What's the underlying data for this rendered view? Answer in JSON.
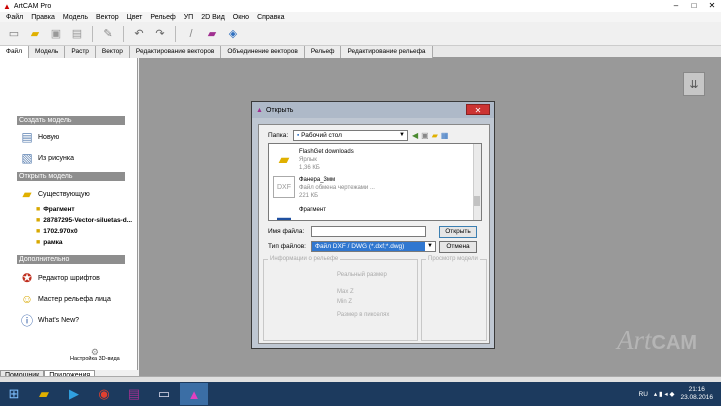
{
  "app": {
    "title": "ArtCAM Pro"
  },
  "window_buttons": [
    "–",
    "□",
    "✕"
  ],
  "menu": [
    "Файл",
    "Правка",
    "Модель",
    "Вектор",
    "Цвет",
    "Рельеф",
    "УП",
    "2D Вид",
    "Окно",
    "Справка"
  ],
  "toolbar": {
    "icons": [
      "new-file-icon",
      "open-folder-icon",
      "save-icon",
      "print-icon",
      "pen-icon",
      "undo-icon",
      "redo-icon",
      "brush-icon",
      "book-icon",
      "layers-icon"
    ]
  },
  "tabs": [
    {
      "label": "Файл",
      "active": true
    },
    {
      "label": "Модель",
      "active": false
    },
    {
      "label": "Растр",
      "active": false
    },
    {
      "label": "Вектор",
      "active": false
    },
    {
      "label": "Редактирование векторов",
      "active": false
    },
    {
      "label": "Объединение векторов",
      "active": false
    },
    {
      "label": "Рельеф",
      "active": false
    },
    {
      "label": "Редактирование рельефа",
      "active": false
    }
  ],
  "left_panel": {
    "create_header": "Создать модель",
    "new_label": "Новую",
    "from_image_label": "Из рисунка",
    "open_header": "Открыть модель",
    "existing_label": "Существующую",
    "recent": [
      "Фрагмент",
      "28787295-Vector-siluetas-d...",
      "1702.970x0",
      "рамка"
    ],
    "extra_header": "Дополнительно",
    "font_editor_label": "Редактор шрифтов",
    "face_relief_label": "Мастер рельефа лица",
    "whats_new_label": "What's New?",
    "view_settings_label": "Настройка 3D-вида"
  },
  "bottom_tabs": [
    {
      "label": "Помощник",
      "active": false
    },
    {
      "label": "Приложения",
      "active": true
    }
  ],
  "dialog": {
    "title": "Открыть",
    "folder_label": "Папка:",
    "folder_value": "Рабочий стол",
    "files": [
      {
        "name": "FlashGet downloads",
        "type": "Ярлык",
        "size": "1,36 КБ"
      },
      {
        "name": "Фанера_3мм",
        "type": "Файл обмена чертежами ...",
        "size": "221 КБ"
      },
      {
        "name": "Фрагмент",
        "type": "",
        "size": ""
      }
    ],
    "filename_label": "Имя файла:",
    "filename_value": "",
    "filetype_label": "Тип файлов:",
    "filetype_value": "Файл DXF / DWG (*.dxf;*.dwg)",
    "open_button": "Открыть",
    "cancel_button": "Отмена",
    "relief_info_title": "Информации о рельефе",
    "relief_size": "Реальный размер",
    "max_z": "Max Z",
    "min_z": "Min Z",
    "pixel_size": "Размер в пикселях",
    "preview_title": "Просмотр модели"
  },
  "watermark": {
    "prefix": "Art",
    "suffix": "CAM"
  },
  "tray": {
    "lang": "RU",
    "time": "21:16",
    "date": "23.08.2016"
  },
  "taskbar": [
    "start-icon",
    "explorer-icon",
    "media-icon",
    "chrome-icon",
    "winrar-icon",
    "notepad-icon",
    "artcam-icon"
  ]
}
